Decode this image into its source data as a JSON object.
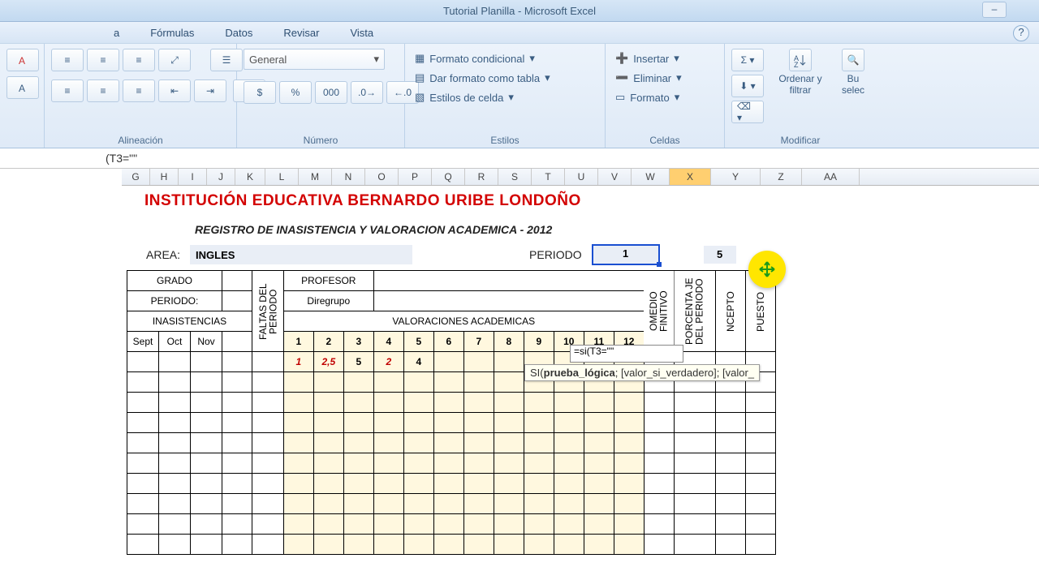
{
  "titlebar": {
    "title": "Tutorial Planilla - Microsoft Excel"
  },
  "menubar": {
    "items": [
      "a",
      "Fórmulas",
      "Datos",
      "Revisar",
      "Vista"
    ]
  },
  "ribbon": {
    "groups": {
      "alignment": {
        "label": "Alineación"
      },
      "number": {
        "label": "Número",
        "format": "General",
        "symbols": [
          "$",
          "%",
          "000"
        ]
      },
      "styles": {
        "label": "Estilos",
        "cond": "Formato condicional",
        "table": "Dar formato como tabla",
        "cell": "Estilos de celda"
      },
      "cells": {
        "label": "Celdas",
        "insert": "Insertar",
        "delete": "Eliminar",
        "format": "Formato"
      },
      "editing": {
        "label": "Modificar",
        "sort": "Ordenar y filtrar",
        "find": "Bu",
        "find2": "selec"
      }
    }
  },
  "formula_bar": "(T3=\"\"",
  "columns": [
    "G",
    "H",
    "I",
    "J",
    "K",
    "L",
    "M",
    "N",
    "O",
    "P",
    "Q",
    "R",
    "S",
    "T",
    "U",
    "V",
    "W",
    "X",
    "Y",
    "Z",
    "AA"
  ],
  "selected_column": "X",
  "doc": {
    "institution": "INSTITUCIÓN EDUCATIVA BERNARDO URIBE LONDOÑO",
    "subtitle": "REGISTRO DE INASISTENCIA Y VALORACION ACADEMICA - 2012",
    "area_label": "AREA:",
    "area_value": "INGLES",
    "periodo_label": "PERIODO",
    "periodo_value": "1",
    "periodo_5": "5",
    "labels": {
      "grado": "GRADO",
      "periodo": "PERIODO:",
      "inasistencias": "INASISTENCIAS",
      "profesor": "PROFESOR",
      "diregrupo": "Diregrupo",
      "valoraciones": "VALORACIONES ACADEMICAS",
      "faltas": "FALTAS DEL PERIODO",
      "omedio": "OMEDIO FINITIVO",
      "porcenta": "PORCENTA JE DEL PERIODO",
      "ncepto": "NCEPTO",
      "puesto": "PUESTO"
    },
    "months": [
      "Sept",
      "Oct",
      "Nov"
    ],
    "val_nums": [
      "1",
      "2",
      "3",
      "4",
      "5",
      "6",
      "7",
      "8",
      "9",
      "10",
      "11",
      "12"
    ],
    "row1": [
      "1",
      "2,5",
      "5",
      "2",
      "4"
    ],
    "formula_cell": "=si(T3=\"\"",
    "tooltip": {
      "pre": "SI(",
      "bold": "prueba_lógica",
      "post": "; [valor_si_verdadero]; [valor_"
    }
  }
}
